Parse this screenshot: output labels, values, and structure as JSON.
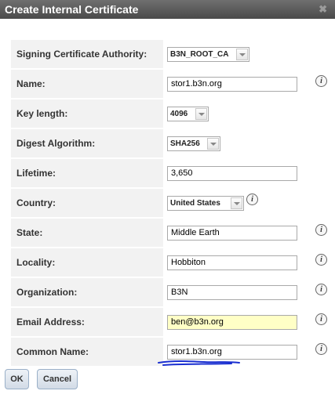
{
  "dialog": {
    "title": "Create Internal Certificate",
    "close_icon": "✖"
  },
  "fields": {
    "ca": {
      "label": "Signing Certificate Authority:",
      "value": "B3N_ROOT_CA"
    },
    "name": {
      "label": "Name:",
      "value": "stor1.b3n.org"
    },
    "key_length": {
      "label": "Key length:",
      "value": "4096"
    },
    "digest": {
      "label": "Digest Algorithm:",
      "value": "SHA256"
    },
    "lifetime": {
      "label": "Lifetime:",
      "value": "3,650"
    },
    "country": {
      "label": "Country:",
      "value": "United States"
    },
    "state": {
      "label": "State:",
      "value": "Middle Earth"
    },
    "locality": {
      "label": "Locality:",
      "value": "Hobbiton"
    },
    "organization": {
      "label": "Organization:",
      "value": "B3N"
    },
    "email": {
      "label": "Email Address:",
      "value": "ben@b3n.org"
    },
    "common_name": {
      "label": "Common Name:",
      "value": "stor1.b3n.org"
    }
  },
  "info_glyph": "i",
  "buttons": {
    "ok": "OK",
    "cancel": "Cancel"
  },
  "colors": {
    "titlebar": "#555555",
    "highlight_input": "#ffffc6",
    "annotation": "#1a2fd0"
  }
}
